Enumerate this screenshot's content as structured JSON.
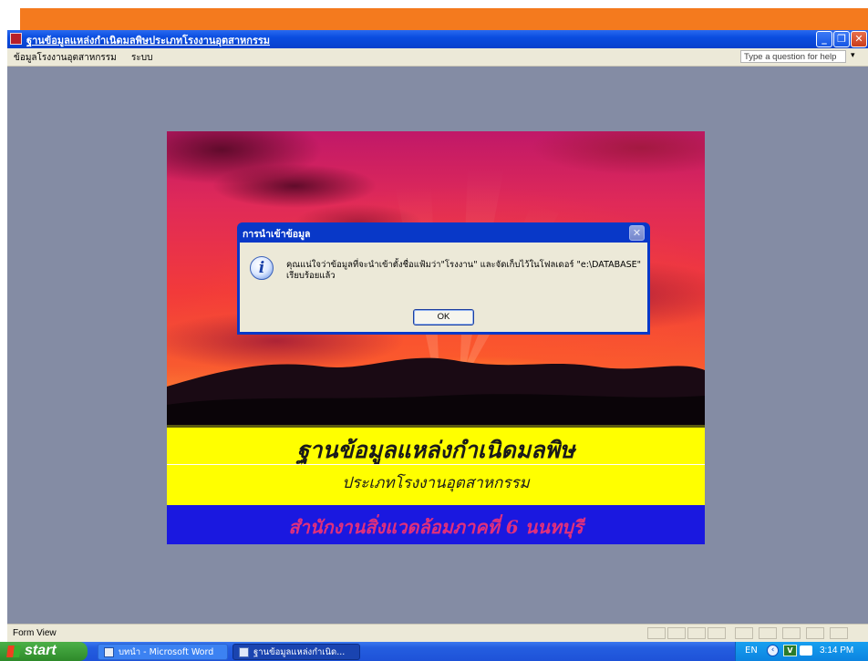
{
  "window": {
    "title": "ฐานข้อมูลแหล่งกำเนิดมลพิษประเภทโรงงานอุตสาหกรรม",
    "controls": {
      "minimize": "_",
      "restore": "❐",
      "close": "✕"
    }
  },
  "menubar": {
    "items": [
      "ข้อมูลโรงงานอุตสาหกรรม",
      "ระบบ"
    ],
    "help_placeholder": "Type a question for help"
  },
  "splash": {
    "title": "ฐานข้อมูลแหล่งกำเนิดมลพิษ",
    "subtitle": "ประเภทโรงงานอุตสาหกรรม",
    "office": "สำนักงานสิ่งแวดล้อมภาคที่ 6 นนทบุรี"
  },
  "dialog": {
    "title": "การนำเข้าข้อมูล",
    "message_line1": "คุณแน่ใจว่าข้อมูลที่จะนำเข้าตั้งชื่อแฟ้มว่า\"โรงงาน\" และจัดเก็บไว้ในโฟลเดอร์ \"e:\\DATABASE\"",
    "message_line2": "เรียบร้อยแล้ว",
    "ok_label": "OK"
  },
  "statusbar": {
    "text": "Form View"
  },
  "taskbar": {
    "start_label": "start",
    "buttons": [
      {
        "label": "บทนำ - Microsoft Word",
        "icon": "word-icon"
      },
      {
        "label": "ฐานข้อมูลแหล่งกำเนิด...",
        "icon": "access-icon"
      }
    ],
    "tray": {
      "language": "EN",
      "clock": "3:14 PM"
    }
  },
  "colors": {
    "titlebar": "#0a4de0",
    "mdi_background": "#848ca4",
    "yellow_band": "#ffff00",
    "blue_band": "#1a18e0",
    "office_text": "#e0307c",
    "orange_bar": "#f47a1e"
  }
}
